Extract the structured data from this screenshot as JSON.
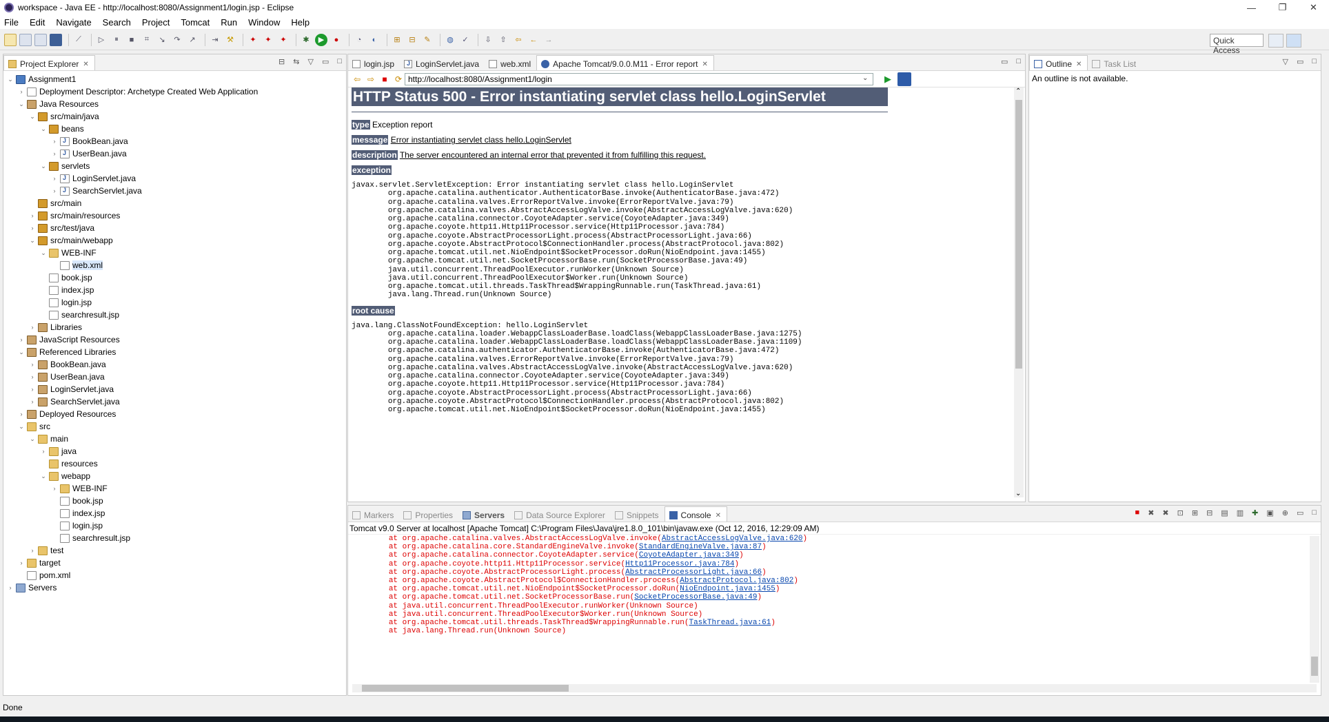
{
  "window": {
    "title": "workspace - Java EE - http://localhost:8080/Assignment1/login.jsp - Eclipse",
    "minimize": "—",
    "maximize": "❐",
    "close": "✕"
  },
  "menu": [
    "File",
    "Edit",
    "Navigate",
    "Search",
    "Project",
    "Tomcat",
    "Run",
    "Window",
    "Help"
  ],
  "toolbar": {
    "quick_access": "Quick Access"
  },
  "project_explorer": {
    "tab_label": "Project Explorer",
    "items": [
      {
        "label": "Assignment1",
        "depth": 0,
        "arrow": "⌄",
        "icon": "project-icon"
      },
      {
        "label": "Deployment Descriptor: Archetype Created Web Application",
        "depth": 1,
        "arrow": "›",
        "icon": "descriptor-icon"
      },
      {
        "label": "Java Resources",
        "depth": 1,
        "arrow": "⌄",
        "icon": "java-resources-icon"
      },
      {
        "label": "src/main/java",
        "depth": 2,
        "arrow": "⌄",
        "icon": "source-folder-icon"
      },
      {
        "label": "beans",
        "depth": 3,
        "arrow": "⌄",
        "icon": "package-icon"
      },
      {
        "label": "BookBean.java",
        "depth": 4,
        "arrow": "›",
        "icon": "java-file-icon"
      },
      {
        "label": "UserBean.java",
        "depth": 4,
        "arrow": "›",
        "icon": "java-file-icon"
      },
      {
        "label": "servlets",
        "depth": 3,
        "arrow": "⌄",
        "icon": "package-icon"
      },
      {
        "label": "LoginServlet.java",
        "depth": 4,
        "arrow": "›",
        "icon": "java-file-icon"
      },
      {
        "label": "SearchServlet.java",
        "depth": 4,
        "arrow": "›",
        "icon": "java-file-icon"
      },
      {
        "label": "src/main",
        "depth": 2,
        "arrow": "",
        "icon": "source-folder-icon"
      },
      {
        "label": "src/main/resources",
        "depth": 2,
        "arrow": "›",
        "icon": "source-folder-icon"
      },
      {
        "label": "src/test/java",
        "depth": 2,
        "arrow": "›",
        "icon": "source-folder-icon"
      },
      {
        "label": "src/main/webapp",
        "depth": 2,
        "arrow": "⌄",
        "icon": "source-folder-icon"
      },
      {
        "label": "WEB-INF",
        "depth": 3,
        "arrow": "⌄",
        "icon": "folder-icon"
      },
      {
        "label": "web.xml",
        "depth": 4,
        "arrow": "",
        "icon": "xml-file-icon",
        "selected": true
      },
      {
        "label": "book.jsp",
        "depth": 3,
        "arrow": "",
        "icon": "jsp-file-icon"
      },
      {
        "label": "index.jsp",
        "depth": 3,
        "arrow": "",
        "icon": "jsp-file-icon"
      },
      {
        "label": "login.jsp",
        "depth": 3,
        "arrow": "",
        "icon": "jsp-file-icon"
      },
      {
        "label": "searchresult.jsp",
        "depth": 3,
        "arrow": "",
        "icon": "jsp-file-icon"
      },
      {
        "label": "Libraries",
        "depth": 2,
        "arrow": "›",
        "icon": "library-icon"
      },
      {
        "label": "JavaScript Resources",
        "depth": 1,
        "arrow": "›",
        "icon": "js-resources-icon"
      },
      {
        "label": "Referenced Libraries",
        "depth": 1,
        "arrow": "⌄",
        "icon": "library-icon"
      },
      {
        "label": "BookBean.java",
        "depth": 2,
        "arrow": "›",
        "icon": "jar-icon"
      },
      {
        "label": "UserBean.java",
        "depth": 2,
        "arrow": "›",
        "icon": "jar-icon"
      },
      {
        "label": "LoginServlet.java",
        "depth": 2,
        "arrow": "›",
        "icon": "jar-icon"
      },
      {
        "label": "SearchServlet.java",
        "depth": 2,
        "arrow": "›",
        "icon": "jar-icon"
      },
      {
        "label": "Deployed Resources",
        "depth": 1,
        "arrow": "›",
        "icon": "deployed-resources-icon"
      },
      {
        "label": "src",
        "depth": 1,
        "arrow": "⌄",
        "icon": "folder-icon"
      },
      {
        "label": "main",
        "depth": 2,
        "arrow": "⌄",
        "icon": "folder-icon"
      },
      {
        "label": "java",
        "depth": 3,
        "arrow": "›",
        "icon": "folder-icon"
      },
      {
        "label": "resources",
        "depth": 3,
        "arrow": "",
        "icon": "folder-icon"
      },
      {
        "label": "webapp",
        "depth": 3,
        "arrow": "⌄",
        "icon": "folder-icon"
      },
      {
        "label": "WEB-INF",
        "depth": 4,
        "arrow": "›",
        "icon": "folder-icon"
      },
      {
        "label": "book.jsp",
        "depth": 4,
        "arrow": "",
        "icon": "jsp-file-icon"
      },
      {
        "label": "index.jsp",
        "depth": 4,
        "arrow": "",
        "icon": "jsp-file-icon"
      },
      {
        "label": "login.jsp",
        "depth": 4,
        "arrow": "",
        "icon": "jsp-file-icon"
      },
      {
        "label": "searchresult.jsp",
        "depth": 4,
        "arrow": "",
        "icon": "jsp-file-icon"
      },
      {
        "label": "test",
        "depth": 2,
        "arrow": "›",
        "icon": "folder-icon"
      },
      {
        "label": "target",
        "depth": 1,
        "arrow": "›",
        "icon": "folder-icon"
      },
      {
        "label": "pom.xml",
        "depth": 1,
        "arrow": "",
        "icon": "xml-file-icon"
      },
      {
        "label": "Servers",
        "depth": 0,
        "arrow": "›",
        "icon": "servers-icon"
      }
    ]
  },
  "editor": {
    "tabs": [
      {
        "label": "login.jsp",
        "active": false
      },
      {
        "label": "LoginServlet.java",
        "active": false
      },
      {
        "label": "web.xml",
        "active": false
      },
      {
        "label": "Apache Tomcat/9.0.0.M11 - Error report",
        "active": true
      }
    ],
    "url": "http://localhost:8080/Assignment1/login",
    "error_page": {
      "heading": "HTTP Status 500 - Error instantiating servlet class hello.LoginServlet",
      "type_label": "type",
      "type_value": "Exception report",
      "message_label": "message",
      "message_value": "Error instantiating servlet class hello.LoginServlet",
      "description_label": "description",
      "description_value": "The server encountered an internal error that prevented it from fulfilling this request.",
      "exception_label": "exception",
      "exception_trace": "javax.servlet.ServletException: Error instantiating servlet class hello.LoginServlet\n\torg.apache.catalina.authenticator.AuthenticatorBase.invoke(AuthenticatorBase.java:472)\n\torg.apache.catalina.valves.ErrorReportValve.invoke(ErrorReportValve.java:79)\n\torg.apache.catalina.valves.AbstractAccessLogValve.invoke(AbstractAccessLogValve.java:620)\n\torg.apache.catalina.connector.CoyoteAdapter.service(CoyoteAdapter.java:349)\n\torg.apache.coyote.http11.Http11Processor.service(Http11Processor.java:784)\n\torg.apache.coyote.AbstractProcessorLight.process(AbstractProcessorLight.java:66)\n\torg.apache.coyote.AbstractProtocol$ConnectionHandler.process(AbstractProtocol.java:802)\n\torg.apache.tomcat.util.net.NioEndpoint$SocketProcessor.doRun(NioEndpoint.java:1455)\n\torg.apache.tomcat.util.net.SocketProcessorBase.run(SocketProcessorBase.java:49)\n\tjava.util.concurrent.ThreadPoolExecutor.runWorker(Unknown Source)\n\tjava.util.concurrent.ThreadPoolExecutor$Worker.run(Unknown Source)\n\torg.apache.tomcat.util.threads.TaskThread$WrappingRunnable.run(TaskThread.java:61)\n\tjava.lang.Thread.run(Unknown Source)",
      "root_cause_label": "root cause",
      "root_cause_trace": "java.lang.ClassNotFoundException: hello.LoginServlet\n\torg.apache.catalina.loader.WebappClassLoaderBase.loadClass(WebappClassLoaderBase.java:1275)\n\torg.apache.catalina.loader.WebappClassLoaderBase.loadClass(WebappClassLoaderBase.java:1109)\n\torg.apache.catalina.authenticator.AuthenticatorBase.invoke(AuthenticatorBase.java:472)\n\torg.apache.catalina.valves.ErrorReportValve.invoke(ErrorReportValve.java:79)\n\torg.apache.catalina.valves.AbstractAccessLogValve.invoke(AbstractAccessLogValve.java:620)\n\torg.apache.catalina.connector.CoyoteAdapter.service(CoyoteAdapter.java:349)\n\torg.apache.coyote.http11.Http11Processor.service(Http11Processor.java:784)\n\torg.apache.coyote.AbstractProcessorLight.process(AbstractProcessorLight.java:66)\n\torg.apache.coyote.AbstractProtocol$ConnectionHandler.process(AbstractProtocol.java:802)\n\torg.apache.tomcat.util.net.NioEndpoint$SocketProcessor.doRun(NioEndpoint.java:1455)"
    }
  },
  "outline": {
    "tabs": [
      "Outline",
      "Task List"
    ],
    "message": "An outline is not available."
  },
  "bottom": {
    "tabs": [
      "Markers",
      "Properties",
      "Servers",
      "Data Source Explorer",
      "Snippets",
      "Console"
    ],
    "active_tab": "Console",
    "console_header": "Tomcat v9.0 Server at localhost [Apache Tomcat] C:\\Program Files\\Java\\jre1.8.0_101\\bin\\javaw.exe (Oct 12, 2016, 12:29:09 AM)",
    "console_lines": [
      {
        "prefix": "\tat org.apache.catalina.valves.AbstractAccessLogValve.invoke(",
        "link": "AbstractAccessLogValve.java:620",
        "suffix": ")"
      },
      {
        "prefix": "\tat org.apache.catalina.core.StandardEngineValve.invoke(",
        "link": "StandardEngineValve.java:87",
        "suffix": ")"
      },
      {
        "prefix": "\tat org.apache.catalina.connector.CoyoteAdapter.service(",
        "link": "CoyoteAdapter.java:349",
        "suffix": ")"
      },
      {
        "prefix": "\tat org.apache.coyote.http11.Http11Processor.service(",
        "link": "Http11Processor.java:784",
        "suffix": ")"
      },
      {
        "prefix": "\tat org.apache.coyote.AbstractProcessorLight.process(",
        "link": "AbstractProcessorLight.java:66",
        "suffix": ")"
      },
      {
        "prefix": "\tat org.apache.coyote.AbstractProtocol$ConnectionHandler.process(",
        "link": "AbstractProtocol.java:802",
        "suffix": ")"
      },
      {
        "prefix": "\tat org.apache.tomcat.util.net.NioEndpoint$SocketProcessor.doRun(",
        "link": "NioEndpoint.java:1455",
        "suffix": ")"
      },
      {
        "prefix": "\tat org.apache.tomcat.util.net.SocketProcessorBase.run(",
        "link": "SocketProcessorBase.java:49",
        "suffix": ")"
      },
      {
        "prefix": "\tat java.util.concurrent.ThreadPoolExecutor.runWorker(Unknown Source)",
        "link": "",
        "suffix": ""
      },
      {
        "prefix": "\tat java.util.concurrent.ThreadPoolExecutor$Worker.run(Unknown Source)",
        "link": "",
        "suffix": ""
      },
      {
        "prefix": "\tat org.apache.tomcat.util.threads.TaskThread$WrappingRunnable.run(",
        "link": "TaskThread.java:61",
        "suffix": ")"
      },
      {
        "prefix": "\tat java.lang.Thread.run(Unknown Source)",
        "link": "",
        "suffix": ""
      }
    ]
  },
  "status": {
    "text": "Done"
  },
  "colors": {
    "error_heading_bg": "#525d76",
    "console_error": "#dd0000",
    "link": "#0645ad"
  }
}
